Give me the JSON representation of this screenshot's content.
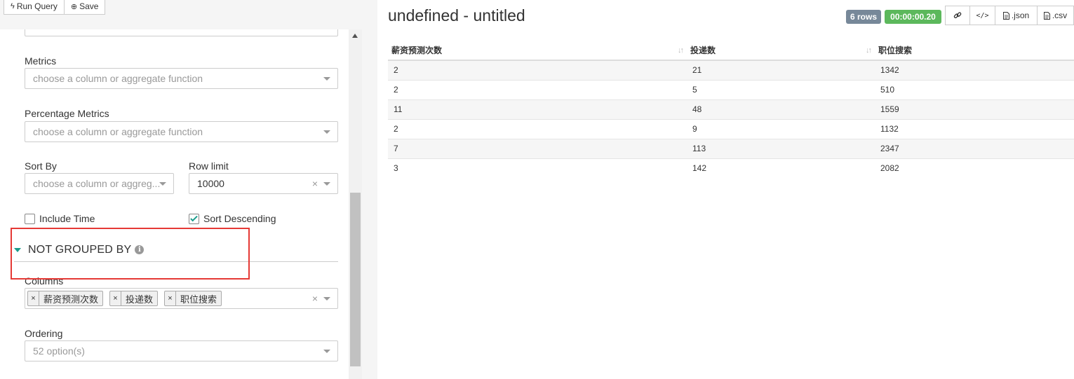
{
  "toolbar": {
    "run_query_label": "Run Query",
    "save_label": "Save"
  },
  "form": {
    "metrics": {
      "label": "Metrics",
      "placeholder": "choose a column or aggregate function"
    },
    "percentage_metrics": {
      "label": "Percentage Metrics",
      "placeholder": "choose a column or aggregate function"
    },
    "sort_by": {
      "label": "Sort By",
      "placeholder": "choose a column or aggreg..."
    },
    "row_limit": {
      "label": "Row limit",
      "value": "10000",
      "clear": "×"
    },
    "include_time": {
      "label": "Include Time",
      "checked": false
    },
    "sort_descending": {
      "label": "Sort Descending",
      "checked": true
    },
    "section": {
      "title": "NOT GROUPED BY",
      "info": "i"
    },
    "columns": {
      "label": "Columns",
      "tags": [
        "薪资预测次数",
        "投递数",
        "职位搜索"
      ],
      "tag_remove": "×",
      "clear": "×"
    },
    "ordering": {
      "label": "Ordering",
      "placeholder": "52 option(s)"
    }
  },
  "result": {
    "title": "undefined - untitled",
    "rows_badge": "6 rows",
    "timer_badge": "00:00:00.20",
    "buttons": {
      "json": ".json",
      "csv": ".csv"
    },
    "columns": [
      "薪资预测次数",
      "投递数",
      "职位搜索"
    ],
    "rows": [
      [
        "2",
        "21",
        "1342"
      ],
      [
        "2",
        "5",
        "510"
      ],
      [
        "11",
        "48",
        "1559"
      ],
      [
        "2",
        "9",
        "1132"
      ],
      [
        "7",
        "113",
        "2347"
      ],
      [
        "3",
        "142",
        "2082"
      ]
    ]
  },
  "colors": {
    "accent": "#1a9c8b",
    "rows_badge": "#778899",
    "timer_badge": "#5cb85c",
    "highlight": "#e53935"
  }
}
